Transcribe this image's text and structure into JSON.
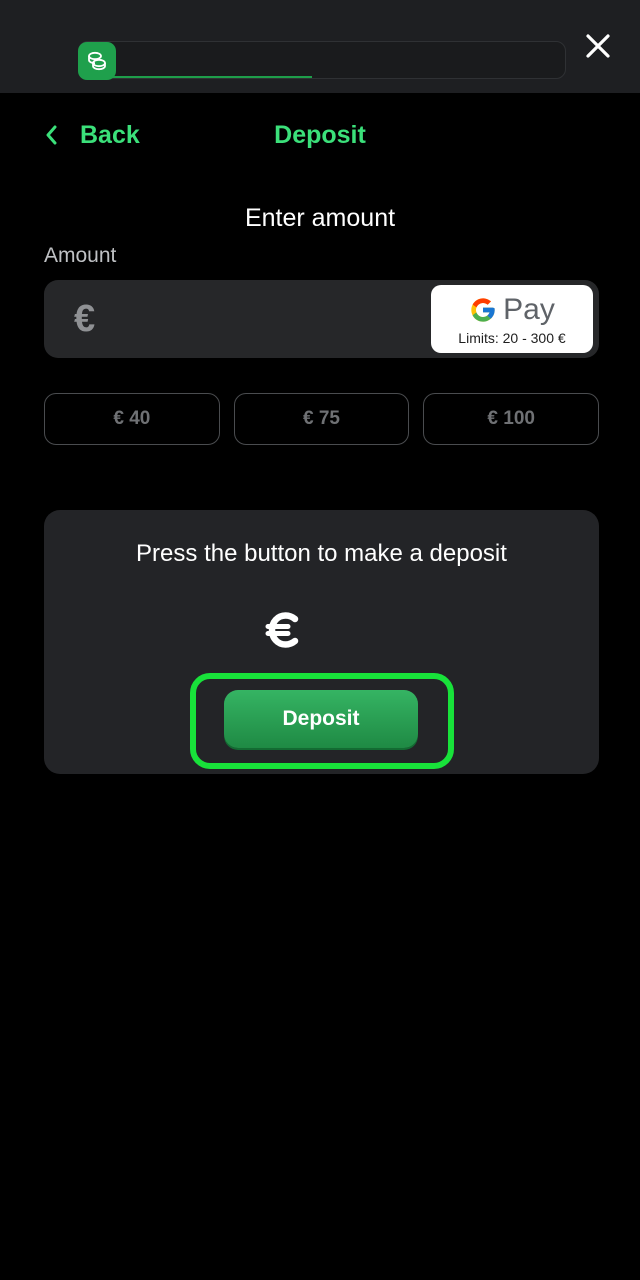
{
  "header": {
    "progress_percent": 48,
    "badge_icon": "coins-icon",
    "close_icon": "close-icon"
  },
  "nav": {
    "back_label": "Back",
    "title": "Deposit"
  },
  "form": {
    "section_title": "Enter amount",
    "amount_label": "Amount",
    "currency_symbol": "€",
    "amount_value": "",
    "payment_method": {
      "name": "Pay",
      "limits": "Limits: 20 - 300 €"
    },
    "quick_amounts": [
      "€ 40",
      "€ 75",
      "€ 100"
    ]
  },
  "panel": {
    "instruction": "Press the button to make a deposit",
    "euro_icon": "euro-icon",
    "button_label": "Deposit"
  },
  "colors": {
    "accent": "#3be07a",
    "button": "#2a9e52",
    "highlight": "#18e23a",
    "background": "#000000",
    "surface": "#232427"
  }
}
